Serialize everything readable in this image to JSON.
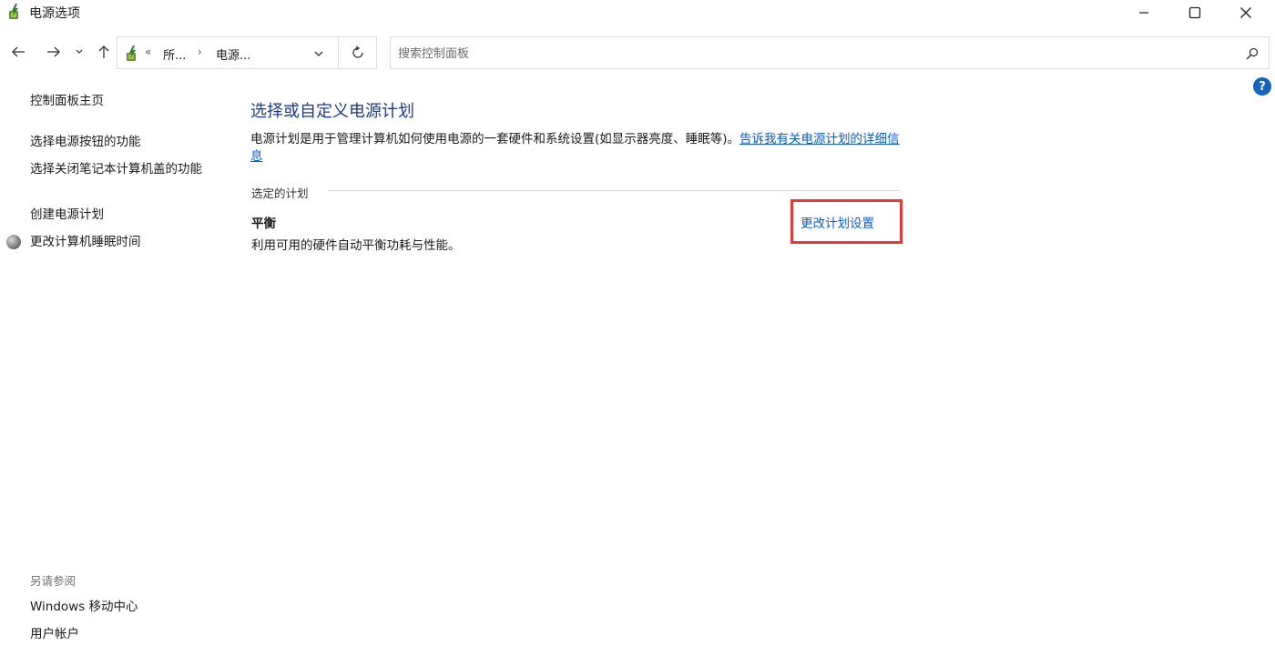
{
  "window": {
    "title": "电源选项",
    "controls": {
      "minimize_icon": "minimize-icon",
      "maximize_icon": "maximize-icon",
      "close_icon": "close-icon"
    }
  },
  "nav": {
    "back_icon": "arrow-left-icon",
    "forward_icon": "arrow-right-icon",
    "recent_icon": "chevron-down-icon",
    "up_icon": "arrow-up-icon",
    "address": {
      "overflow": "«",
      "segments": [
        "所...",
        "电源..."
      ],
      "separator": "›"
    },
    "refresh_icon": "refresh-icon",
    "search": {
      "placeholder": "搜索控制面板",
      "value": ""
    }
  },
  "sidebar": {
    "items": [
      {
        "label": "控制面板主页"
      },
      {
        "label": "选择电源按钮的功能"
      },
      {
        "label": "选择关闭笔记本计算机盖的功能"
      },
      {
        "label": "创建电源计划"
      },
      {
        "label": "更改计算机睡眠时间",
        "icon": "shield-icon"
      }
    ],
    "see_also": {
      "heading": "另请参阅",
      "items": [
        {
          "label": "Windows 移动中心"
        },
        {
          "label": "用户帐户"
        }
      ]
    }
  },
  "main": {
    "title": "选择或自定义电源计划",
    "description": "电源计划是用于管理计算机如何使用电源的一套硬件和系统设置(如显示器亮度、睡眠等)。",
    "description_link": "告诉我有关电源计划的详细信息",
    "section_label": "选定的计划",
    "plan": {
      "name": "平衡",
      "description": "利用可用的硬件自动平衡功耗与性能。",
      "change_link": "更改计划设置"
    }
  },
  "colors": {
    "title_blue": "#1e3a8a",
    "link_blue": "#0b5ccc",
    "highlight_red": "#e53935",
    "help_blue": "#1565c0"
  },
  "help_icon": "?"
}
